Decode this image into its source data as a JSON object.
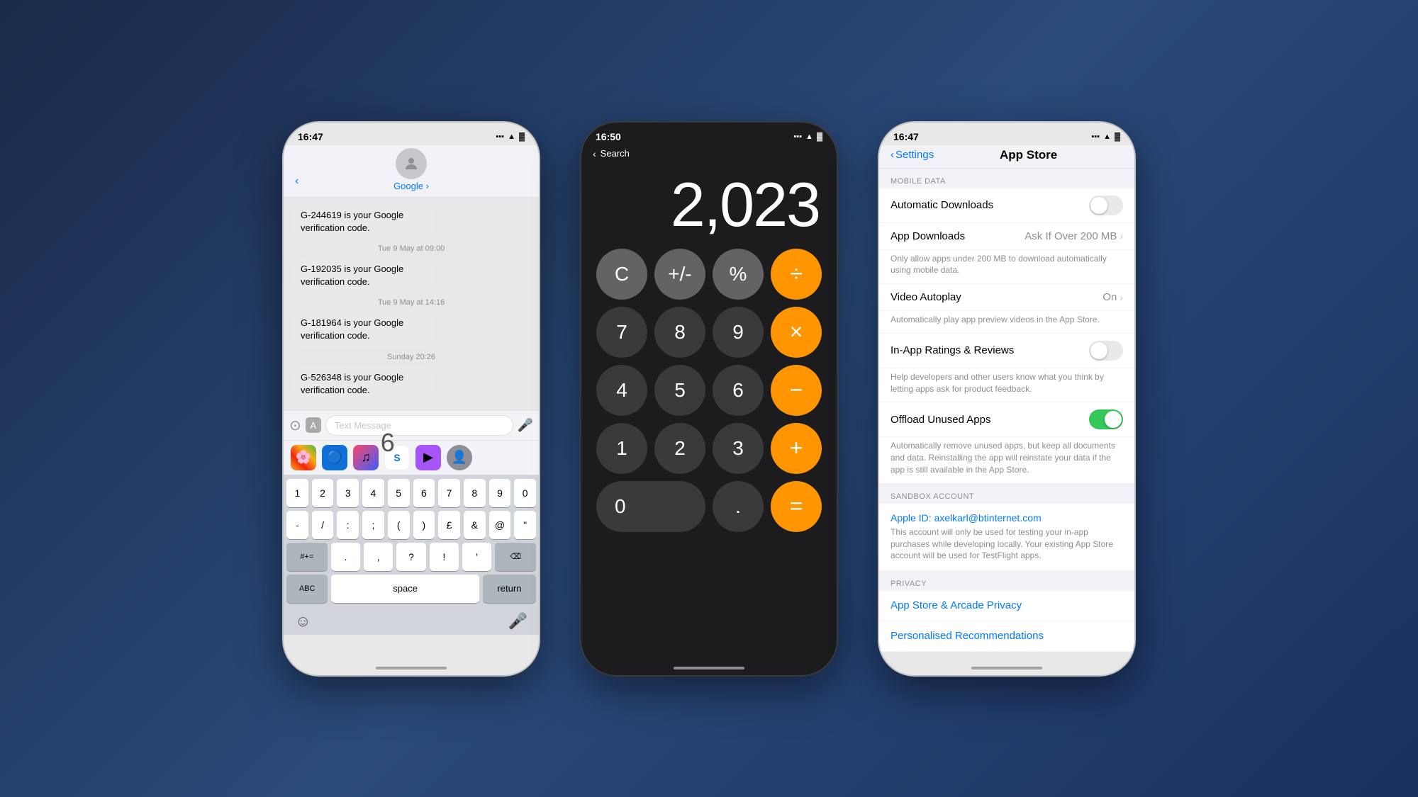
{
  "background": "#2a4a7a",
  "phone1": {
    "time": "16:47",
    "contact": "Google",
    "messages": [
      {
        "text": "G-244619 is your Google verification code.",
        "timestamp": null
      },
      {
        "timestamp": "Tue 9 May at 09:00",
        "text": null
      },
      {
        "text": "G-192035 is your Google verification code.",
        "timestamp": null
      },
      {
        "timestamp": "Tue 9 May at 14:16",
        "text": null
      },
      {
        "text": "G-181964 is your Google verification code.",
        "timestamp": null
      },
      {
        "timestamp": "Sunday 20:26",
        "text": null
      },
      {
        "text": "G-526348 is your Google verification code.",
        "timestamp": null
      }
    ],
    "input_placeholder": "Text Message",
    "keyboard": {
      "number_row": [
        "1",
        "2",
        "3",
        "4",
        "5",
        "6",
        "7",
        "8",
        "9",
        "0"
      ],
      "symbol_row": [
        "-",
        "/",
        ":",
        ";",
        "(",
        ")",
        "£",
        "&",
        "@",
        "\""
      ],
      "special_left": "#+=",
      "special_keys": [
        ".",
        ",",
        "?",
        "!",
        "'"
      ],
      "delete": "⌫",
      "bottom": [
        "ABC",
        "space",
        "return"
      ],
      "big_number": "6"
    }
  },
  "phone2": {
    "time": "16:50",
    "back_label": "Search",
    "display_value": "2,023",
    "buttons": [
      [
        "C",
        "+/-",
        "%",
        "÷"
      ],
      [
        "7",
        "8",
        "9",
        "×"
      ],
      [
        "4",
        "5",
        "6",
        "−"
      ],
      [
        "1",
        "2",
        "3",
        "+"
      ],
      [
        "0",
        ".",
        "="
      ]
    ]
  },
  "phone3": {
    "time": "16:47",
    "back_label": "Settings",
    "title": "App Store",
    "sections": {
      "mobile_data": "MOBILE DATA",
      "sandbox": "SANDBOX ACCOUNT",
      "privacy": "PRIVACY"
    },
    "cells": [
      {
        "id": "automatic_downloads",
        "title": "Automatic Downloads",
        "toggle": "off",
        "desc": null
      },
      {
        "id": "app_downloads",
        "title": "App Downloads",
        "value": "Ask If Over 200 MB",
        "chevron": true,
        "desc": "Only allow apps under 200 MB to download automatically using mobile data."
      },
      {
        "id": "video_autoplay",
        "title": "Video Autoplay",
        "value": "On",
        "chevron": true,
        "desc": "Automatically play app preview videos in the App Store."
      },
      {
        "id": "in_app_ratings",
        "title": "In-App Ratings & Reviews",
        "toggle": "off",
        "desc": "Help developers and other users know what you think by letting apps ask for product feedback."
      },
      {
        "id": "offload_unused",
        "title": "Offload Unused Apps",
        "toggle": "on",
        "desc": "Automatically remove unused apps, but keep all documents and data. Reinstalling the app will reinstate your data if the app is still available in the App Store."
      }
    ],
    "sandbox_id": "Apple ID: axelkarl@btinternet.com",
    "sandbox_desc": "This account will only be used for testing your in-app purchases while developing locally. Your existing App Store account will be used for TestFlight apps.",
    "privacy_links": [
      "App Store & Arcade Privacy",
      "Personalised Recommendations"
    ]
  }
}
